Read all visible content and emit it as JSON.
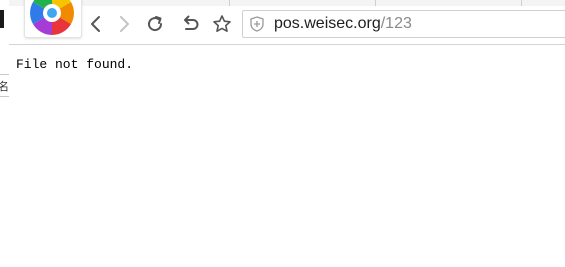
{
  "browser": {
    "address_bar": {
      "host": "pos.weisec.org",
      "path": "/123"
    },
    "toolbar": {
      "back_icon": "chevron-left-icon",
      "forward_icon": "chevron-right-icon",
      "reload_icon": "reload-icon",
      "undo_icon": "undo-icon",
      "bookmark_icon": "star-icon",
      "security_icon": "shield-icon"
    },
    "logo_icon": "browser-logo-icon"
  },
  "page": {
    "body_text": "File not found."
  },
  "background_window": {
    "glyph": "名"
  },
  "colors": {
    "icon": "#555555",
    "icon_disabled": "#c4c4c4",
    "url_host": "#202020",
    "url_path": "#8a8a8a"
  }
}
